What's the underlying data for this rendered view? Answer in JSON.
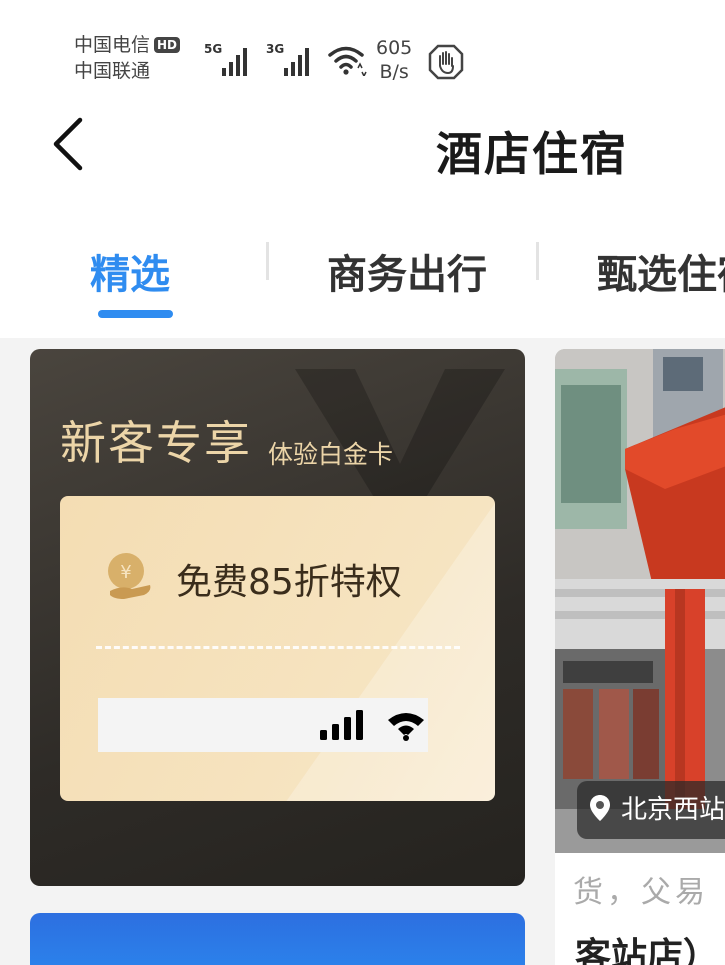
{
  "status_bar": {
    "carrier_1": "中国电信",
    "carrier_1_badge": "HD",
    "carrier_2": "中国联通",
    "signal_1_label": "5G",
    "signal_2_label": "3G",
    "net_speed_value": "605",
    "net_speed_unit": "B/s"
  },
  "header": {
    "title": "酒店住宿"
  },
  "tabs": [
    {
      "label": "精选",
      "active": true
    },
    {
      "label": "商务出行",
      "active": false
    },
    {
      "label": "甄选住宿",
      "active": false
    }
  ],
  "promo": {
    "title": "新客专享",
    "subtitle": "体验白金卡",
    "benefit": "免费85折特权",
    "icon": "yen-coin-hand-icon"
  },
  "hotel_card": {
    "location": "北京西站",
    "description": "货，父易",
    "name": "客站店）"
  },
  "colors": {
    "accent": "#2f8cf0",
    "promo_bg": "#2e2b27",
    "promo_gold": "#ecd5a8",
    "card_bg": "#f4ddb3"
  }
}
